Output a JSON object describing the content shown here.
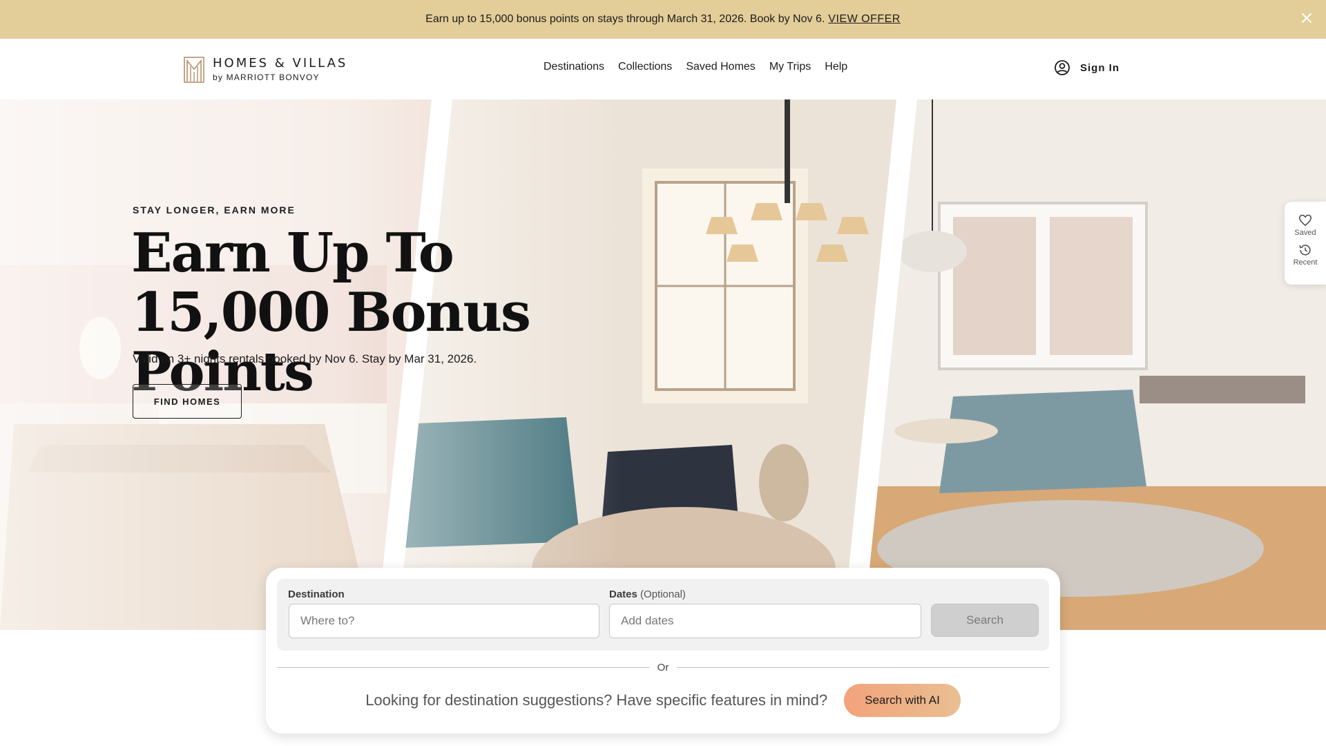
{
  "colors": {
    "banner_bg": "#e3cd98",
    "ai_button_gradient_start": "#f3a27a",
    "ai_button_gradient_end": "#e9bf91",
    "search_button_bg": "#cfcfcf",
    "text_primary": "#1c1c1c"
  },
  "banner": {
    "text": "Earn up to 15,000 bonus points on stays through March 31, 2026. Book by Nov 6.",
    "link_label": "VIEW OFFER",
    "close_icon": "close-icon"
  },
  "header": {
    "logo_main": "HOMES & VILLAS",
    "logo_sub": "by MARRIOTT BONVOY",
    "nav": [
      {
        "label": "Destinations"
      },
      {
        "label": "Collections"
      },
      {
        "label": "Saved Homes"
      },
      {
        "label": "My Trips"
      },
      {
        "label": "Help"
      }
    ],
    "sign_in_label": "Sign In",
    "sign_in_icon": "user-circle-icon"
  },
  "hero": {
    "eyebrow": "STAY LONGER, EARN MORE",
    "title": "Earn Up To 15,000 Bonus Points",
    "subtitle": "Valid on 3+ nights rentals booked by Nov 6. Stay by Mar 31, 2026.",
    "cta_label": "FIND HOMES"
  },
  "side_rail": {
    "items": [
      {
        "label": "Saved",
        "icon": "heart-icon"
      },
      {
        "label": "Recent",
        "icon": "history-icon"
      }
    ]
  },
  "search": {
    "destination_label": "Destination",
    "destination_placeholder": "Where to?",
    "destination_value": "",
    "dates_label": "Dates",
    "dates_optional": "(Optional)",
    "dates_placeholder": "Add dates",
    "dates_value": "",
    "search_button_label": "Search",
    "or_label": "Or",
    "ai_prompt": "Looking for destination suggestions? Have specific features in mind?",
    "ai_button_label": "Search with AI"
  }
}
